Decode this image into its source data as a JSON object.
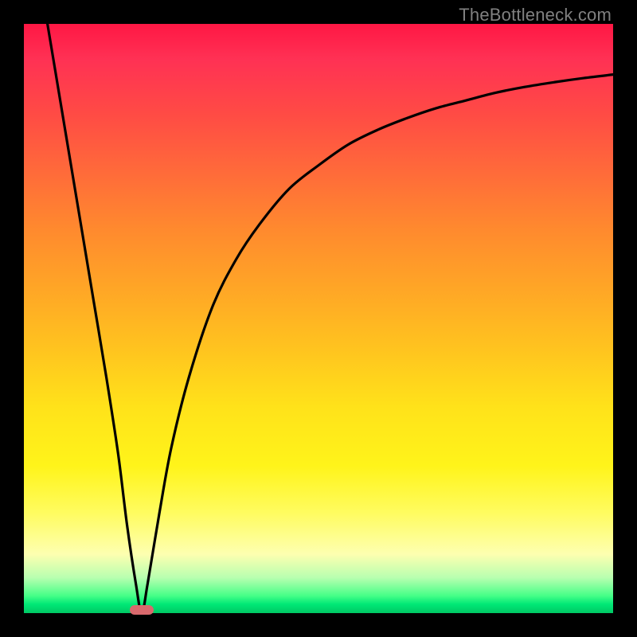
{
  "attribution": "TheBottleneck.com",
  "colors": {
    "top": "#ff1744",
    "mid": "#ffe21a",
    "bottom": "#00c864",
    "border": "#000000",
    "curve": "#000000",
    "marker": "#d9696d",
    "attribution_text": "#808080"
  },
  "chart_data": {
    "type": "line",
    "title": "",
    "xlabel": "",
    "ylabel": "",
    "xlim": [
      0,
      100
    ],
    "ylim": [
      0,
      100
    ],
    "x": [
      4,
      6,
      8,
      10,
      12,
      14,
      16,
      17.5,
      19,
      20,
      21,
      23,
      25,
      28,
      32,
      36,
      40,
      45,
      50,
      55,
      60,
      65,
      70,
      75,
      80,
      85,
      90,
      95,
      100
    ],
    "y": [
      100,
      88,
      76,
      64,
      52,
      40,
      27,
      15,
      5,
      0,
      5,
      17,
      28,
      40,
      52,
      60,
      66,
      72,
      76,
      79.5,
      82,
      84,
      85.7,
      87,
      88.3,
      89.3,
      90.1,
      90.8,
      91.4
    ],
    "marker": {
      "x_center": 20,
      "width_pct": 4.0,
      "y": 0
    },
    "notes": "Axes are unlabeled in the source image; x and y are normalized to 0–100 spanning the plot area. The curve touches 0 at roughly x≈20 and rises asymptotically toward ~91 on the right."
  }
}
